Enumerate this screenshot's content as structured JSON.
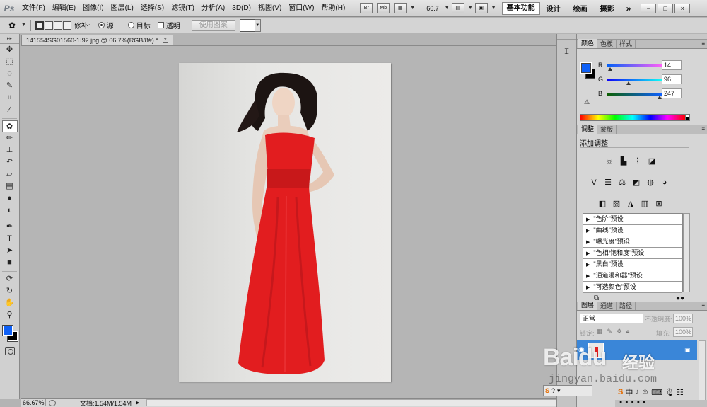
{
  "app": {
    "logo": "Ps",
    "menu": [
      "文件(F)",
      "编辑(E)",
      "图像(I)",
      "图层(L)",
      "选择(S)",
      "滤镜(T)",
      "分析(A)",
      "3D(D)",
      "视图(V)",
      "窗口(W)",
      "帮助(H)"
    ],
    "bridge_btn": "Br",
    "minibridge_btn": "Mb",
    "zoom_dropdown": "66.7",
    "workspaces": {
      "active": "基本功能",
      "items": [
        "设计",
        "绘画",
        "摄影"
      ],
      "more": "»"
    },
    "window_controls": [
      "−",
      "□",
      "×"
    ]
  },
  "options": {
    "patch_label": "修补:",
    "source_label": "源",
    "destination_label": "目标",
    "transparent_label": "透明",
    "use_pattern_label": "使用图案",
    "source_selected": true
  },
  "document": {
    "tab_title": "141554SG01560-1I92.jpg @ 66.7%(RGB/8#) *",
    "close_glyph": "×",
    "status": {
      "zoom": "66.67%",
      "doc_size": "文档:1.54M/1.54M"
    }
  },
  "colors": {
    "foreground": "#0e60f7",
    "background": "#000000",
    "dress": "#e21d1f",
    "layer_selected": "#3a86d8"
  },
  "panels": {
    "color_tabs": [
      "颜色",
      "色板",
      "样式"
    ],
    "rgb": [
      {
        "label": "R",
        "value": "14"
      },
      {
        "label": "G",
        "value": "96"
      },
      {
        "label": "B",
        "value": "247"
      }
    ],
    "adjust_tabs": [
      "调整",
      "蒙版"
    ],
    "adjust_title": "添加调整",
    "adjust_presets": [
      "\"色阶\"预设",
      "\"曲线\"预设",
      "\"曝光度\"预设",
      "\"色相/饱和度\"预设",
      "\"黑白\"预设",
      "\"通道混和器\"预设",
      "\"可选颜色\"预设"
    ],
    "layers_tabs": [
      "图层",
      "通道",
      "路径"
    ],
    "blend_mode": "正常",
    "opacity_label": "不透明度:",
    "opacity_value": "100%",
    "lock_label": "锁定:",
    "fill_label": "填充:",
    "fill_value": "100%"
  },
  "overlay": {
    "baidu_logo": "Baidu",
    "baidu_text": "经验",
    "sub_url": "jingyan.baidu.com",
    "ime_2_cn": "中"
  }
}
